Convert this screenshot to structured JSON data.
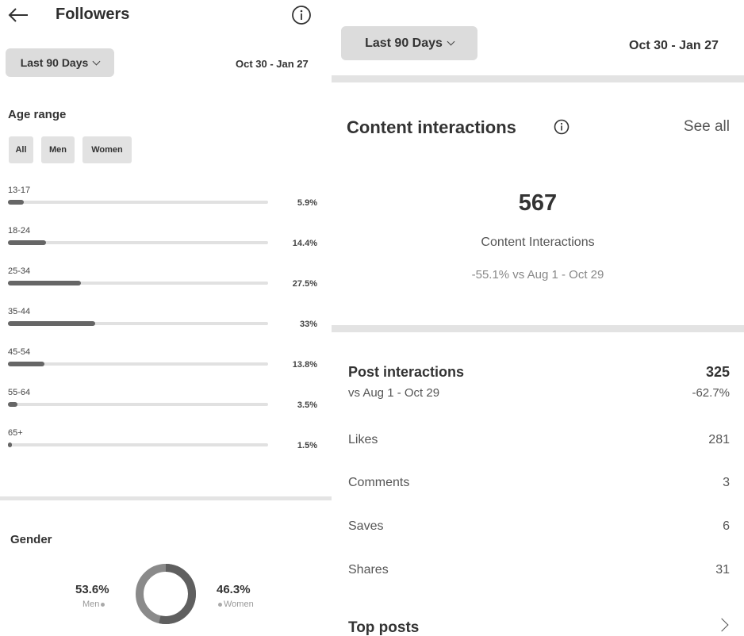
{
  "left": {
    "header": {
      "title": "Followers"
    },
    "date_filter": {
      "label": "Last 90 Days",
      "range": "Oct 30 - Jan 27"
    },
    "age": {
      "title": "Age range",
      "filters": [
        "All",
        "Men",
        "Women"
      ],
      "rows": [
        {
          "label": "13-17",
          "pct": "5.9%",
          "value": 5.9
        },
        {
          "label": "18-24",
          "pct": "14.4%",
          "value": 14.4
        },
        {
          "label": "25-34",
          "pct": "27.5%",
          "value": 27.5
        },
        {
          "label": "35-44",
          "pct": "33%",
          "value": 33
        },
        {
          "label": "45-54",
          "pct": "13.8%",
          "value": 13.8
        },
        {
          "label": "55-64",
          "pct": "3.5%",
          "value": 3.5
        },
        {
          "label": "65+",
          "pct": "1.5%",
          "value": 1.5
        }
      ]
    },
    "gender": {
      "title": "Gender",
      "men_value": "53.6%",
      "men_label": "Men",
      "women_value": "46.3%",
      "women_label": "Women",
      "men_share": 53.6,
      "women_share": 46.3
    }
  },
  "right": {
    "date_filter": {
      "label": "Last 90 Days",
      "range": "Oct 30 - Jan 27"
    },
    "content": {
      "title": "Content interactions",
      "see_all": "See all",
      "total": "567",
      "total_label": "Content Interactions",
      "comparison": "-55.1% vs Aug 1 - Oct 29"
    },
    "post": {
      "title": "Post interactions",
      "value": "325",
      "comparison": "vs Aug 1 - Oct 29",
      "change": "-62.7%"
    },
    "metrics": [
      {
        "label": "Likes",
        "value": "281"
      },
      {
        "label": "Comments",
        "value": "3"
      },
      {
        "label": "Saves",
        "value": "6"
      },
      {
        "label": "Shares",
        "value": "31"
      }
    ],
    "top_posts": "Top posts"
  },
  "colors": {
    "bar_fill": "#666666",
    "bar_track": "#e1e1e1",
    "chip_bg": "#dcdcdc",
    "divider": "#e3e3e3"
  }
}
